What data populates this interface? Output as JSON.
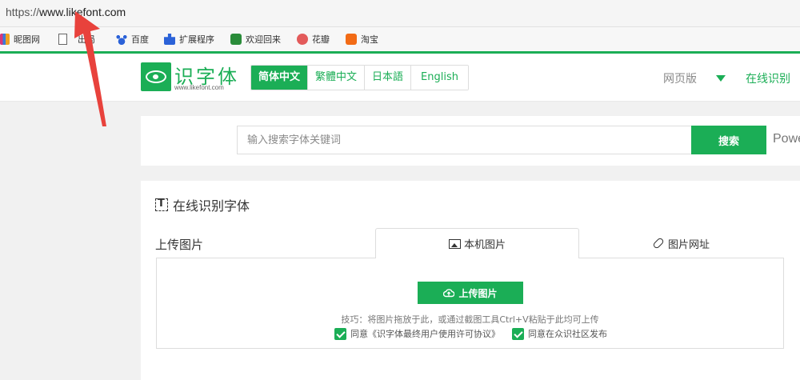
{
  "browser": {
    "url_prefix": "https://",
    "url_host": "www.likefont.com",
    "bookmarks": [
      {
        "label": "昵图网",
        "icon": "nipic-icon",
        "color": "#d9367a"
      },
      {
        "label": "出局",
        "icon": "document-icon",
        "color": "#ffffff"
      },
      {
        "label": "百度",
        "icon": "baidu-paw-icon",
        "color": "#2b62d8"
      },
      {
        "label": "扩展程序",
        "icon": "puzzle-icon",
        "color": "#2b62d8"
      },
      {
        "label": "欢迎回来",
        "icon": "evernote-icon",
        "color": "#2a8c3a"
      },
      {
        "label": "花瓣",
        "icon": "huaban-icon",
        "color": "#e35b5b"
      },
      {
        "label": "淘宝",
        "icon": "taobao-icon",
        "color": "#f26b16"
      }
    ]
  },
  "header": {
    "logo_title": "识字体",
    "logo_sub": "www.likefont.com",
    "languages": [
      {
        "label": "简体中文",
        "active": true
      },
      {
        "label": "繁體中文",
        "active": false
      },
      {
        "label": "日本語",
        "active": false
      },
      {
        "label": "English",
        "active": false
      }
    ],
    "web_version": "网页版",
    "online_identify": "在线识别"
  },
  "search": {
    "placeholder": "输入搜索字体关键词",
    "button": "搜索",
    "powered": "Powe"
  },
  "identify": {
    "title": "在线识别字体",
    "upload_label": "上传图片",
    "tab_local": "本机图片",
    "tab_url": "图片网址",
    "upload_button": "上传图片",
    "tip": "技巧：将图片拖放于此，或通过截图工具Ctrl+V粘贴于此均可上传",
    "agree_license": "同意《识字体最终用户使用许可协议》",
    "agree_publish": "同意在众识社区发布"
  },
  "colors": {
    "accent": "#1bae56",
    "arrow": "#e8423c"
  }
}
